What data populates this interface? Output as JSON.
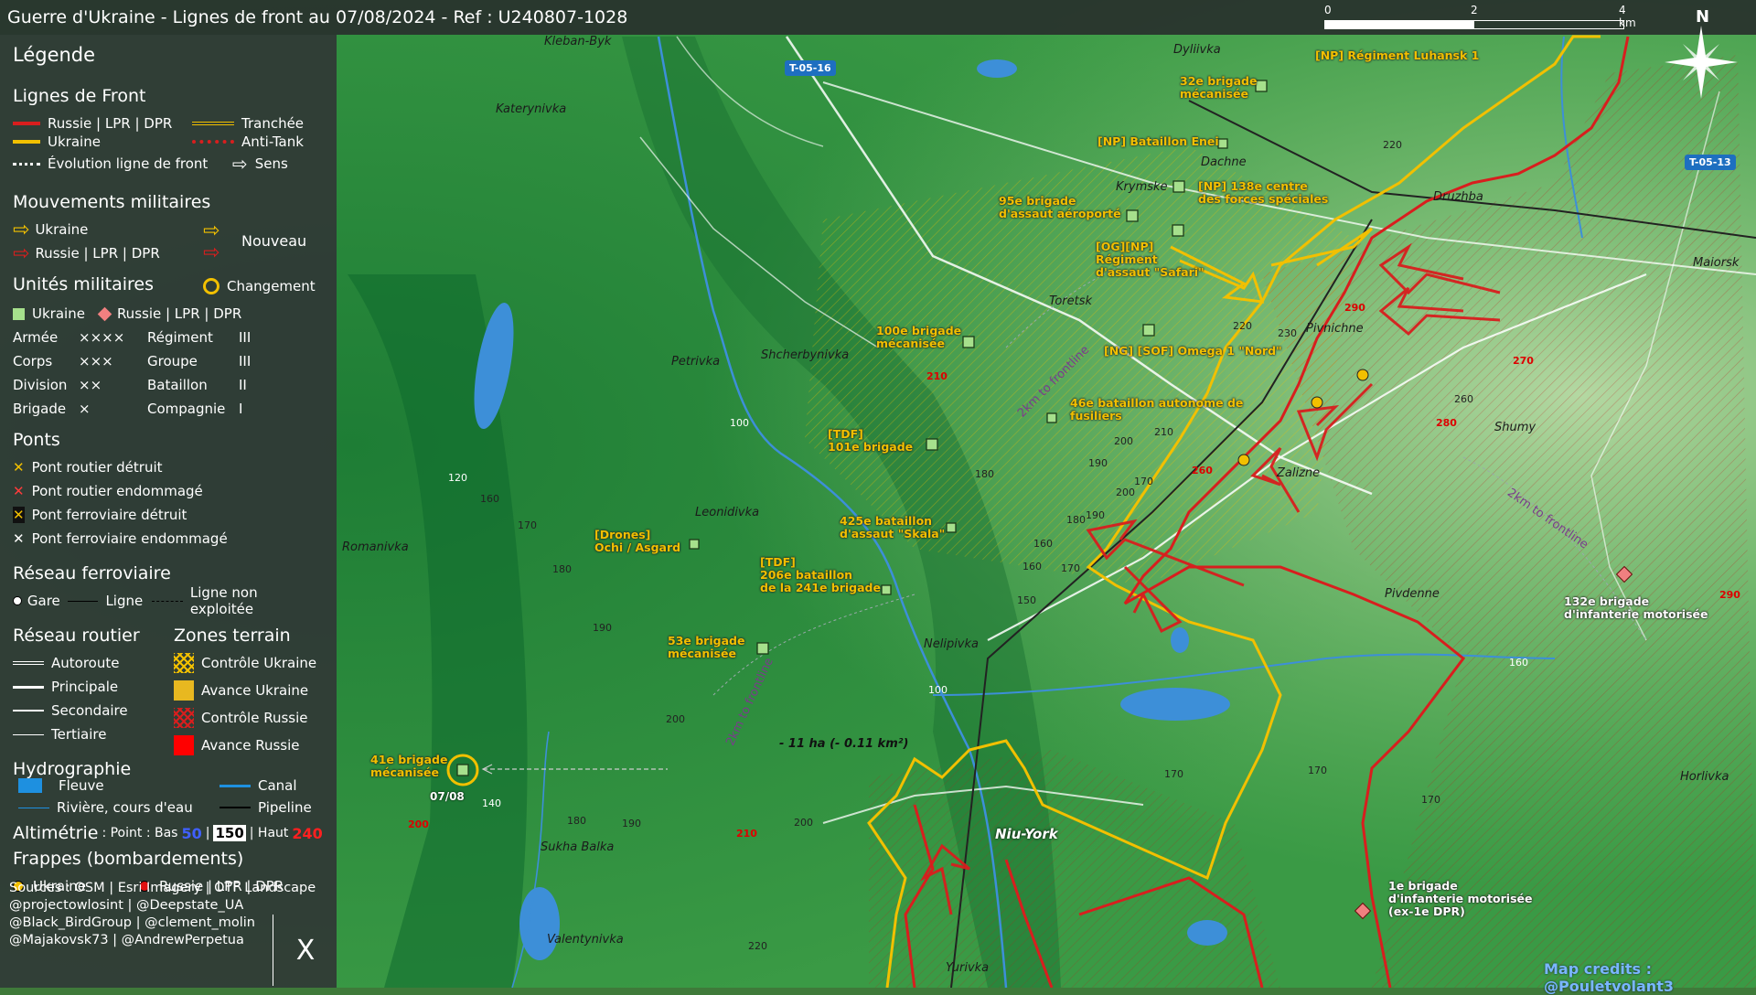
{
  "title": "Guerre d'Ukraine - Lignes de front au 07/08/2024 - Ref : U240807-1028",
  "scale": {
    "t0": "0",
    "t2": "2",
    "t4": "4 km"
  },
  "north": "N",
  "legend": {
    "heading": "Légende",
    "front_title": "Lignes de Front",
    "front_russia": "Russie | LPR | DPR",
    "front_ukraine": "Ukraine",
    "front_evolution": "Évolution ligne de front",
    "front_trench": "Tranchée",
    "front_antitank": "Anti-Tank",
    "front_direction": "Sens",
    "moves_title": "Mouvements militaires",
    "moves_ukraine": "Ukraine",
    "moves_russia": "Russie | LPR | DPR",
    "moves_new": "Nouveau",
    "units_title": "Unités militaires",
    "units_change": "Changement",
    "units_ukraine": "Ukraine",
    "units_russia": "Russie | LPR | DPR",
    "echelons": [
      {
        "a": "Armée",
        "b": "××××",
        "c": "Régiment",
        "d": "III"
      },
      {
        "a": "Corps",
        "b": "×××",
        "c": "Groupe",
        "d": "III"
      },
      {
        "a": "Division",
        "b": "××",
        "c": "Bataillon",
        "d": "II"
      },
      {
        "a": "Brigade",
        "b": "×",
        "c": "Compagnie",
        "d": "I"
      }
    ],
    "bridges_title": "Ponts",
    "bridge1": "Pont routier détruit",
    "bridge2": "Pont routier endommagé",
    "bridge3": "Pont ferroviaire détruit",
    "bridge4": "Pont ferroviaire endommagé",
    "rail_title": "Réseau ferroviaire",
    "rail_station": "Gare",
    "rail_line": "Ligne",
    "rail_unused": "Ligne non exploitée",
    "road_title": "Réseau routier",
    "road1": "Autoroute",
    "road2": "Principale",
    "road3": "Secondaire",
    "road4": "Tertiaire",
    "zones_title": "Zones terrain",
    "zone1": "Contrôle Ukraine",
    "zone2": "Avance Ukraine",
    "zone3": "Contrôle Russie",
    "zone4": "Avance Russie",
    "hydro_title": "Hydrographie",
    "hydro1": "Fleuve",
    "hydro2": "Canal",
    "hydro3": "Rivière, cours d'eau",
    "hydro4": "Pipeline",
    "alt_title": "Altimétrie",
    "alt_text": ": Point : Bas",
    "alt_low": "50",
    "alt_mid": "150",
    "alt_high_label": "| Haut",
    "alt_high": "240",
    "strikes_title": "Frappes (bombardements)",
    "strikes_ukraine": "Ukraine",
    "strikes_russia": "Russie | LPR | DPR",
    "sources": [
      "Sources : OSM | Esri Imagery | OTF Landscape",
      "@projectowlosint | @Deepstate_UA",
      "@Black_BirdGroup | @clement_molin",
      "@Majakovsk73 | @AndrewPerpetua"
    ],
    "x_logo": "X"
  },
  "colors": {
    "russia": "#d81e1e",
    "ukraine": "#f2c000",
    "water": "#3d8fd8",
    "panel": "#30383a"
  },
  "places": [
    {
      "id": "kleban",
      "t": "Kleban-Byk"
    },
    {
      "id": "katerynivka",
      "t": "Katerynivka"
    },
    {
      "id": "dyliivka",
      "t": "Dyliivka"
    },
    {
      "id": "dachne",
      "t": "Dachne"
    },
    {
      "id": "krymske",
      "t": "Krymske"
    },
    {
      "id": "druzhba",
      "t": "Druzhba"
    },
    {
      "id": "maiorsk",
      "t": "Maiorsk"
    },
    {
      "id": "toretsk",
      "t": "Toretsk"
    },
    {
      "id": "pivnichne",
      "t": "Pivnichne"
    },
    {
      "id": "petrivka",
      "t": "Petrivka"
    },
    {
      "id": "shcherbynivka",
      "t": "Shcherbynivka"
    },
    {
      "id": "shumy",
      "t": "Shumy"
    },
    {
      "id": "zalizne",
      "t": "Zalizne"
    },
    {
      "id": "leonidivka",
      "t": "Leonidivka"
    },
    {
      "id": "romanivka",
      "t": "Romanivka"
    },
    {
      "id": "pivdenne",
      "t": "Pivdenne"
    },
    {
      "id": "nelipivka",
      "t": "Nelipivka"
    },
    {
      "id": "niuyork",
      "t": "Niu-York"
    },
    {
      "id": "horlivka",
      "t": "Horlivka"
    },
    {
      "id": "sukha",
      "t": "Sukha Balka"
    },
    {
      "id": "valentynivka",
      "t": "Valentynivka"
    },
    {
      "id": "yurivka",
      "t": "Yurivka"
    }
  ],
  "units": [
    {
      "id": "u1",
      "t": "[NP] Régiment Luhansk 1"
    },
    {
      "id": "u2",
      "t": "32e brigade\nmécanisée"
    },
    {
      "id": "u3",
      "t": "[NP] Bataillon Enei"
    },
    {
      "id": "u4",
      "t": "[NP] 138e centre\ndes forces spéciales"
    },
    {
      "id": "u5",
      "t": "95e brigade\nd'assaut aéroporté"
    },
    {
      "id": "u6",
      "t": "[OG][NP]\nRégiment\nd'assaut \"Safari\""
    },
    {
      "id": "u7",
      "t": "100e brigade\nmécanisée"
    },
    {
      "id": "u8",
      "t": "[NG] [SOF] Omega 1 \"Nord\""
    },
    {
      "id": "u9",
      "t": "46e bataillon autonome de\nfusiliers"
    },
    {
      "id": "u10",
      "t": "[TDF]\n101e brigade"
    },
    {
      "id": "u11",
      "t": "425e bataillon\nd'assaut \"Skala\""
    },
    {
      "id": "u12",
      "t": "[Drones]\nOchi / Asgard"
    },
    {
      "id": "u13",
      "t": "[TDF]\n206e bataillon\nde la 241e brigade"
    },
    {
      "id": "u14",
      "t": "53e brigade\nmécanisée"
    },
    {
      "id": "u15",
      "t": "41e brigade\nmécanisée"
    },
    {
      "id": "u16",
      "t": "132e brigade\nd'infanterie motorisée"
    },
    {
      "id": "u17",
      "t": "1e brigade\nd'infanterie motorisée\n(ex-1e DPR)"
    }
  ],
  "roads": [
    {
      "id": "r1",
      "t": "T-05-16"
    },
    {
      "id": "r2",
      "t": "T-05-13"
    }
  ],
  "misc": {
    "date_tag": "07/08",
    "area_change": "- 11 ha (- 0.11 km²)",
    "frontline_label": "2km to frontline",
    "credits": "Map credits : @Pouletvolant3"
  },
  "altitudes": [
    "220",
    "230",
    "220",
    "260",
    "210",
    "200",
    "190",
    "180",
    "170",
    "160",
    "150",
    "170",
    "180",
    "190",
    "200",
    "170",
    "160",
    "170",
    "180",
    "190",
    "200",
    "220",
    "170",
    "160",
    "140",
    "120",
    "100",
    "100",
    "160",
    "180",
    "190",
    "200",
    "170"
  ],
  "altitudes_red": [
    "290",
    "270",
    "280",
    "260",
    "210",
    "210",
    "200",
    "290"
  ]
}
